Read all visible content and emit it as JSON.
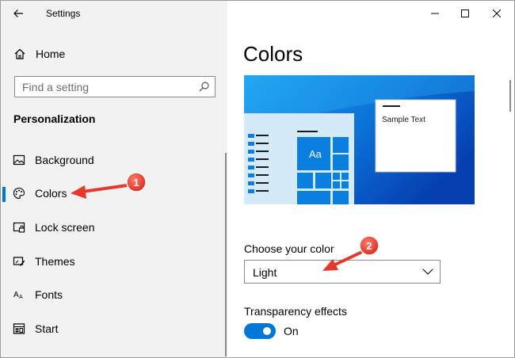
{
  "window": {
    "title": "Settings"
  },
  "sidebar": {
    "home_label": "Home",
    "search_placeholder": "Find a setting",
    "section_title": "Personalization",
    "items": [
      {
        "label": "Background",
        "icon": "picture-icon",
        "active": false
      },
      {
        "label": "Colors",
        "icon": "palette-icon",
        "active": true
      },
      {
        "label": "Lock screen",
        "icon": "lock-screen-icon",
        "active": false
      },
      {
        "label": "Themes",
        "icon": "themes-icon",
        "active": false
      },
      {
        "label": "Fonts",
        "icon": "fonts-icon",
        "active": false
      },
      {
        "label": "Start",
        "icon": "start-icon",
        "active": false
      }
    ]
  },
  "main": {
    "title": "Colors",
    "preview": {
      "sample_text": "Sample Text",
      "tile_text": "Aa"
    },
    "color_choice": {
      "label": "Choose your color",
      "value": "Light"
    },
    "transparency": {
      "label": "Transparency effects",
      "state": "On",
      "enabled": true
    }
  },
  "annotations": [
    {
      "number": "1",
      "target": "Colors"
    },
    {
      "number": "2",
      "target": "Choose your color"
    }
  ],
  "colors": {
    "accent": "#0078d7",
    "annotation": "#e8382c",
    "sidebar_bg": "#f2f2f2"
  }
}
